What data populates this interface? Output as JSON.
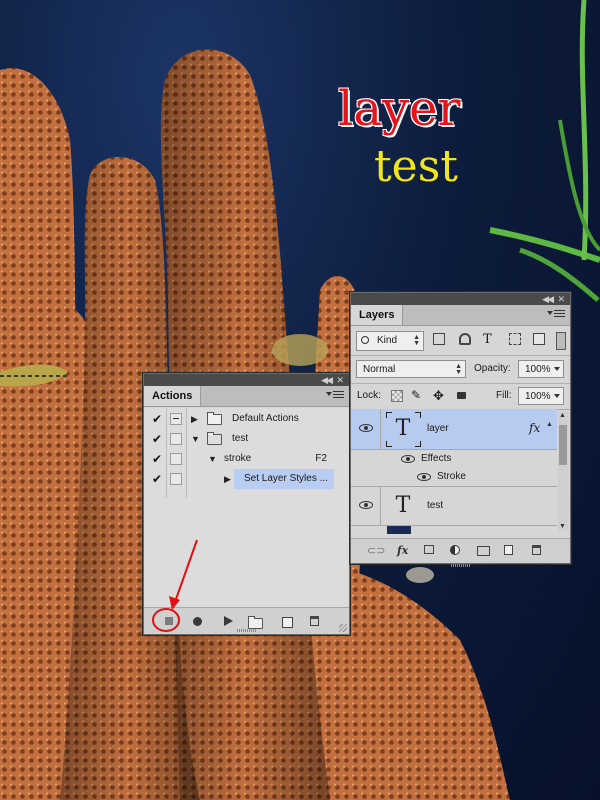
{
  "canvas": {
    "text_line_1": "layer",
    "text_line_2": "test",
    "text_color_1": "#e4141b",
    "text_color_2": "#f2e61a"
  },
  "actions_panel": {
    "tab": "Actions",
    "rows": [
      {
        "label": "Default Actions",
        "checked": true,
        "dialog": true,
        "expanded": false,
        "kind": "set"
      },
      {
        "label": "test",
        "checked": true,
        "dialog": false,
        "expanded": true,
        "kind": "set"
      },
      {
        "label": "stroke",
        "checked": true,
        "dialog": false,
        "expanded": true,
        "kind": "action",
        "shortcut": "F2"
      },
      {
        "label": "Set Layer Styles ...",
        "checked": true,
        "dialog": false,
        "expanded": false,
        "kind": "command",
        "selected": true
      }
    ],
    "bottom_buttons": [
      "stop-icon",
      "record-icon",
      "play-icon",
      "new-set-icon",
      "new-action-icon",
      "delete-icon"
    ],
    "highlighted_button": "stop-icon"
  },
  "layers_panel": {
    "tab": "Layers",
    "filter_kind": "Kind",
    "blend_mode": "Normal",
    "opacity_label": "Opacity:",
    "opacity_value": "100%",
    "lock_label": "Lock:",
    "fill_label": "Fill:",
    "fill_value": "100%",
    "layers": [
      {
        "name": "layer",
        "type": "text",
        "selected": true,
        "fx": "fx",
        "effects_label": "Effects",
        "effects": [
          "Stroke"
        ]
      },
      {
        "name": "test",
        "type": "text",
        "selected": false
      }
    ],
    "bottom_icons": [
      "link-icon",
      "fx-icon",
      "mask-icon",
      "adjustment-icon",
      "group-folder-icon",
      "new-layer-icon",
      "trash-icon"
    ]
  }
}
